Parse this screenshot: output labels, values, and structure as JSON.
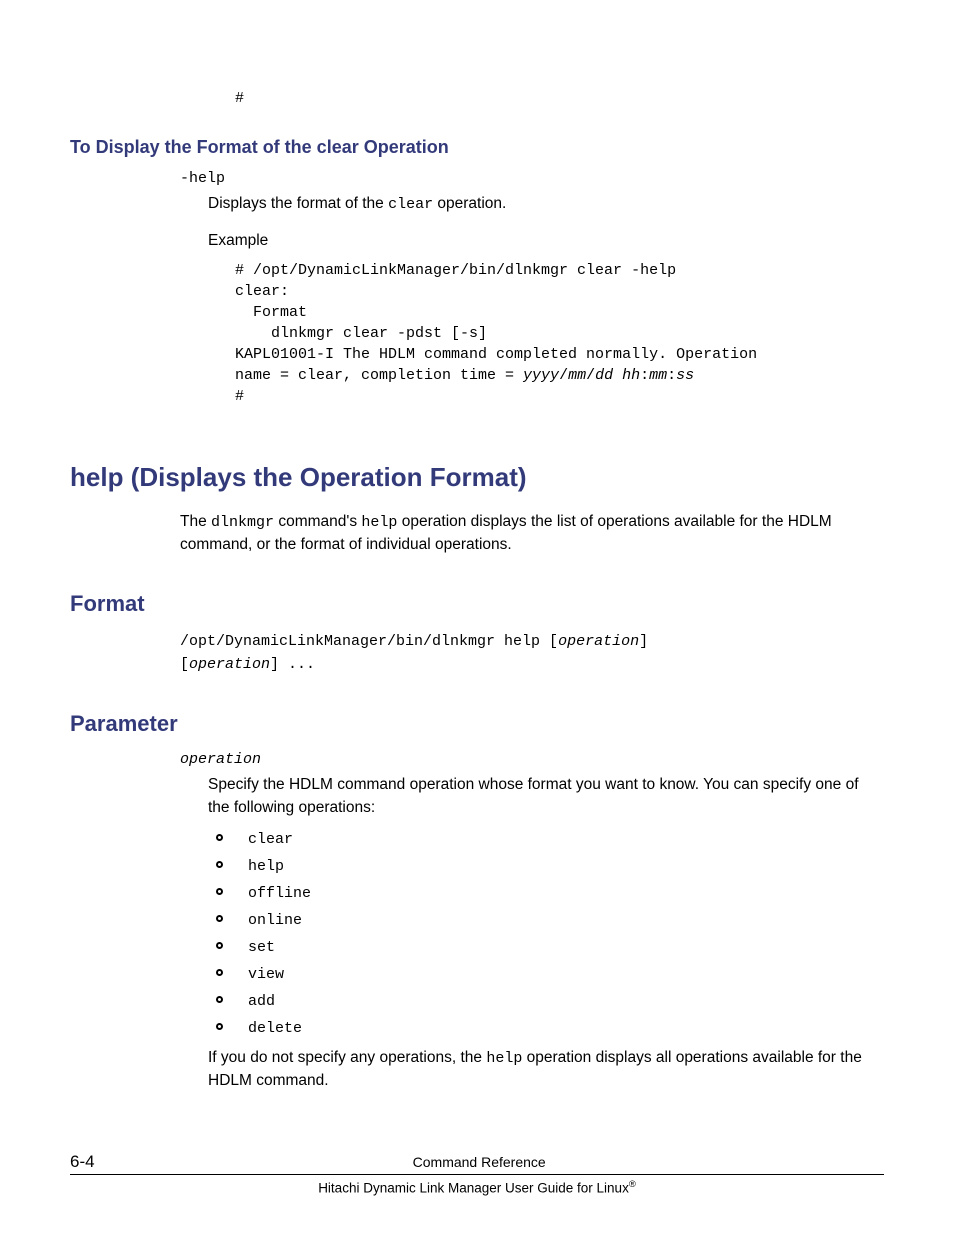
{
  "top_hash": "#",
  "section_clear_help": {
    "heading": "To Display the Format of the clear Operation",
    "term": "-help",
    "desc_pre": "Displays the format of the ",
    "desc_code": "clear",
    "desc_post": " operation.",
    "example_label": "Example",
    "code": "# /opt/DynamicLinkManager/bin/dlnkmgr clear -help\nclear:\n  Format\n    dlnkmgr clear -pdst [-s]\nKAPL01001-I The HDLM command completed normally. Operation\nname = clear, completion time = ",
    "code_italic": "yyyy",
    "code2": "/",
    "code_italic2": "mm",
    "code3": "/",
    "code_italic3": "dd hh",
    "code4": ":",
    "code_italic4": "mm",
    "code5": ":",
    "code_italic5": "ss",
    "code_end": "\n#"
  },
  "section_help": {
    "heading": "help (Displays the Operation Format)",
    "intro_pre": "The ",
    "intro_code1": "dlnkmgr",
    "intro_mid1": " command's ",
    "intro_code2": "help",
    "intro_post": " operation displays the list of operations available for the HDLM command, or the format of individual operations."
  },
  "section_format": {
    "heading": "Format",
    "line1_pre": "/opt/DynamicLinkManager/bin/dlnkmgr help [",
    "line1_it": "operation",
    "line1_post": "]",
    "line2_pre": "[",
    "line2_it": "operation",
    "line2_post": "] ..."
  },
  "section_parameter": {
    "heading": "Parameter",
    "term": "operation",
    "desc": "Specify the HDLM command operation whose format you want to know. You can specify one of the following operations:",
    "ops": [
      "clear",
      "help",
      "offline",
      "online",
      "set",
      "view",
      "add",
      "delete"
    ],
    "after_pre": "If you do not specify any operations, the ",
    "after_code": "help",
    "after_post": " operation displays all operations available for the HDLM command."
  },
  "footer": {
    "page": "6-4",
    "title": "Command Reference",
    "book_pre": "Hitachi Dynamic Link Manager User Guide for Linux",
    "book_sup": "®"
  }
}
